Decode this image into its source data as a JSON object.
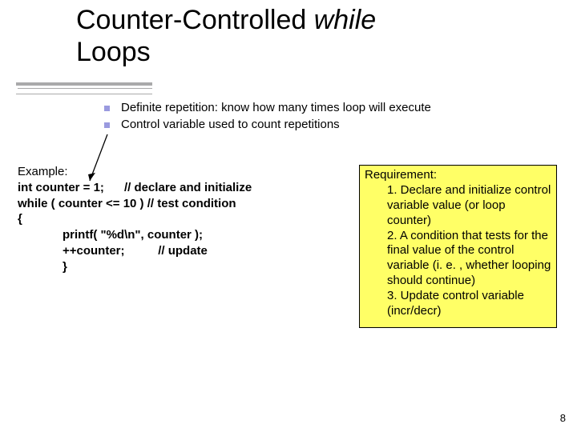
{
  "title": {
    "part1": "Counter-Controlled ",
    "part2_italic": "while",
    "part3": "Loops"
  },
  "bullets": [
    "Definite repetition: know how many times loop will execute",
    "Control variable used to count repetitions"
  ],
  "example": {
    "header": "Example:",
    "l1a": "int counter = 1;",
    "l1b": "// declare and initialize",
    "l2a": "while ( counter <= 10 )",
    "l2b": " // test condition",
    "l3": "{",
    "l4": "printf( \"%d\\n\", counter );",
    "l5a": "++counter;",
    "l5b": "// update",
    "l6": "}"
  },
  "req": {
    "header": "Requirement:",
    "p1": "1. Declare and initialize control variable value (or loop counter)",
    "p2": "2. A condition that tests for the final value of the control variable (i. e. , whether looping should continue)",
    "p3": "3. Update control variable (incr/decr)"
  },
  "page_number": "8"
}
